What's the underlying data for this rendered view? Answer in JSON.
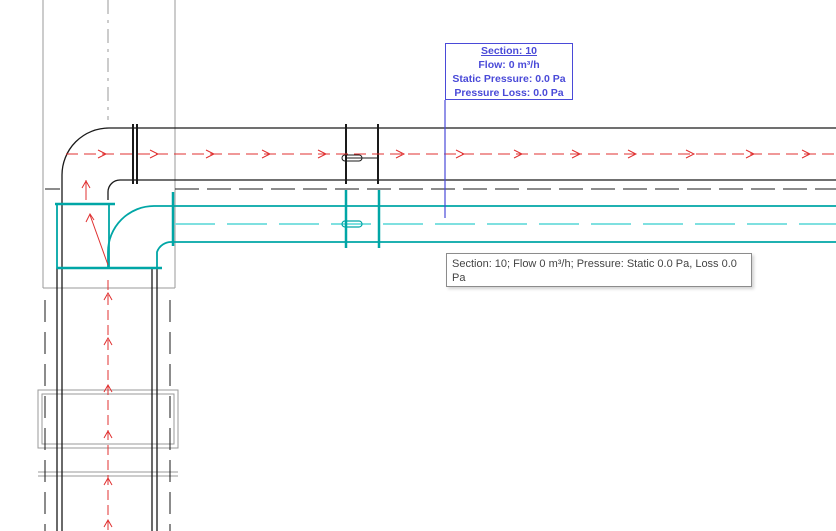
{
  "section_tag": {
    "title": "Section: 10",
    "flow": "Flow: 0 m³/h",
    "static_pressure": "Static Pressure: 0.0 Pa",
    "pressure_loss": "Pressure Loss: 0.0 Pa"
  },
  "tooltip": {
    "text": "Section: 10; Flow 0 m³/h; Pressure: Static 0.0 Pa, Loss 0.0 Pa"
  },
  "colors": {
    "duct": "#1a1a1a",
    "selected_duct": "#00a6a6",
    "flow_arrow": "#e03030",
    "tag": "#4a4ad8",
    "gray": "#999999"
  }
}
